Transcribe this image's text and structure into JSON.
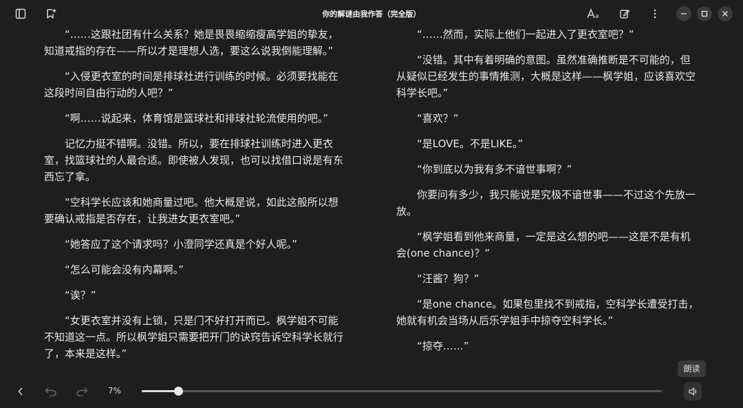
{
  "window": {
    "title": "你的解谜由我作答（完全版）"
  },
  "toolbar": {
    "left_icons": [
      "sidebar-toggle-icon",
      "bookmark-add-icon"
    ],
    "right_icons": [
      "font-settings-icon",
      "annotate-icon",
      "more-icon"
    ]
  },
  "page_left": {
    "paragraphs": [
      "“……这跟社团有什么关系？她是畏畏缩缩瘦高学姐的挚友，知道戒指的存在——所以才是理想人选，要这么说我倒能理解。”",
      "“入侵更衣室的时间是排球社进行训练的时候。必须要找能在这段时间自由行动的人吧？”",
      "“啊……说起来，体育馆是篮球社和排球社轮流使用的吧。”",
      "记忆力挺不错啊。没错。所以，要在排球社训练时进入更衣室，找篮球社的人最合适。即使被人发现，也可以找借口说是有东西忘了拿。",
      "“空科学长应该和她商量过吧。他大概是说，如此这般所以想要确认戒指是否存在，让我进女更衣室吧。”",
      "“她答应了这个请求吗？小澄同学还真是个好人呢。”",
      "“怎么可能会没有内幕啊。”",
      "“诶？”",
      "“女更衣室并没有上锁，只是门不好打开而已。枫学姐不可能不知道这一点。所以枫学姐只需要把开门的诀窍告诉空科学长就行了，本来是这样。”"
    ]
  },
  "page_right": {
    "paragraphs": [
      "“……然而，实际上他们一起进入了更衣室吧？”",
      "“没错。其中有着明确的意图。虽然准确推断是不可能的，但从疑似已经发生的事情推测，大概是这样——枫学姐，应该喜欢空科学长吧。”",
      "“喜欢？”",
      "“是LOVE。不是LIKE。”",
      "“你到底以为我有多不谙世事啊？”",
      "你要问有多少，我只能说是究极不谙世事——不过这个先放一放。",
      "“枫学姐看到他来商量，一定是这么想的吧——这是不是有机会(one chance)？”",
      "“汪酱？狗？”",
      "“是one chance。如果包里找不到戒指，空科学长遭受打击，她就有机会当场从后乐学姐手中掠夺空科学长。”",
      "“掠夺……”"
    ]
  },
  "footer": {
    "progress_label": "7%",
    "progress_value": 0.07,
    "tooltip": "朗读",
    "icons": [
      "back-icon",
      "undo-icon",
      "redo-icon",
      "read-aloud-icon"
    ]
  },
  "colors": {
    "background": "#1e1e1e",
    "text": "#e8e8e8",
    "accent": "#dddddd"
  }
}
